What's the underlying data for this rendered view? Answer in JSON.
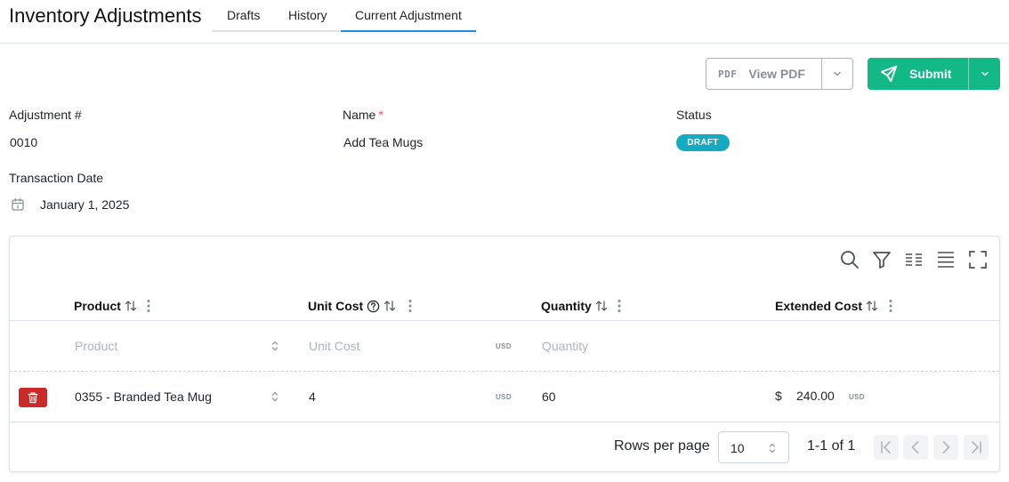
{
  "header": {
    "title": "Inventory Adjustments",
    "tabs": [
      {
        "label": "Drafts"
      },
      {
        "label": "History"
      },
      {
        "label": "Current Adjustment"
      }
    ]
  },
  "actions": {
    "pdf_icon_text": "PDF",
    "view_pdf_label": "View PDF",
    "submit_label": "Submit"
  },
  "fields": {
    "adjustment_number": {
      "label": "Adjustment #",
      "value": "0010"
    },
    "name": {
      "label": "Name",
      "required_mark": "*",
      "value": "Add Tea Mugs"
    },
    "status": {
      "label": "Status",
      "value": "DRAFT"
    },
    "transaction_date": {
      "label": "Transaction Date",
      "value": "January 1, 2025"
    }
  },
  "table": {
    "toolbar_icons": [
      "search-icon",
      "filter-icon",
      "columns-icon",
      "density-icon",
      "fullscreen-icon"
    ],
    "columns": [
      {
        "label": "Product"
      },
      {
        "label": "Unit Cost"
      },
      {
        "label": "Quantity"
      },
      {
        "label": "Extended Cost"
      }
    ],
    "new_row": {
      "product_placeholder": "Product",
      "unit_cost_placeholder": "Unit Cost",
      "unit_cost_currency": "USD",
      "quantity_placeholder": "Quantity"
    },
    "rows": [
      {
        "product": "0355 - Branded Tea Mug",
        "unit_cost": "4",
        "unit_cost_currency": "USD",
        "quantity": "60",
        "extended_cost_symbol": "$",
        "extended_cost": "240.00",
        "extended_cost_currency": "USD"
      }
    ],
    "pagination": {
      "rows_per_page_label": "Rows per page",
      "rows_per_page_value": "10",
      "range_text": "1-1 of 1"
    }
  },
  "colors": {
    "accent": "#228be6",
    "submit": "#12b886",
    "status_badge": "#15aabf",
    "delete": "#c92a2a"
  }
}
